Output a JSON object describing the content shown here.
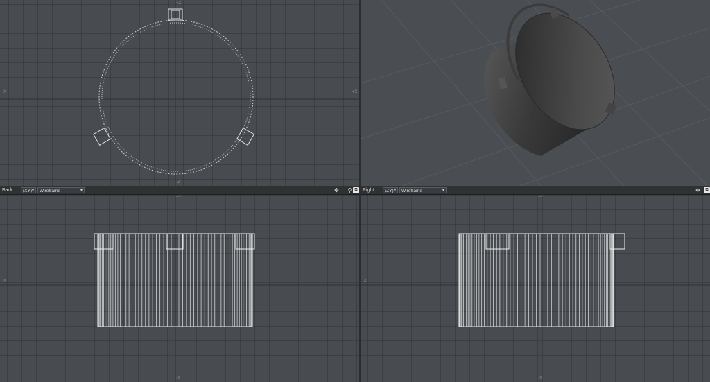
{
  "viewports": {
    "back": {
      "view_name": "Back",
      "plane": "(XY)",
      "mode": "Wireframe"
    },
    "right": {
      "view_name": "Right",
      "plane": "(ZY)",
      "mode": "Wireframe"
    }
  },
  "icons": {
    "move": "move-view-icon",
    "zoom": "zoom-view-icon",
    "maximize": "maximize-view-icon"
  },
  "colors": {
    "viewport_bg": "#484c50",
    "wireframe": "#e6e6e6",
    "header_bg": "#2f3133"
  }
}
